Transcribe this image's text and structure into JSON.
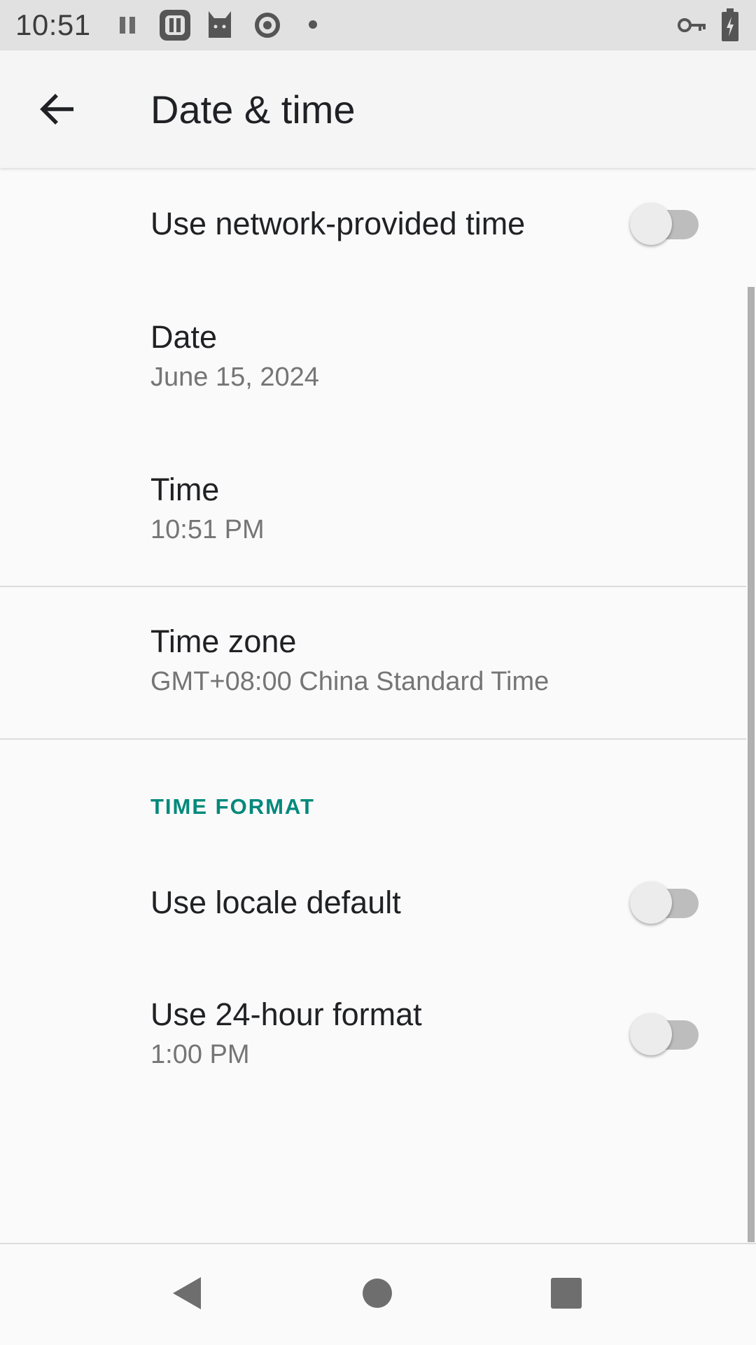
{
  "status_bar": {
    "time": "10:51",
    "icons": [
      "pause-icon",
      "app-icon",
      "cat-icon",
      "sync-icon",
      "dot-icon",
      "vpn-key-icon",
      "battery-charging-icon"
    ]
  },
  "app_bar": {
    "back_icon": "arrow-back-icon",
    "title": "Date & time"
  },
  "settings": {
    "network_time": {
      "title": "Use network-provided time",
      "enabled": false
    },
    "date": {
      "title": "Date",
      "value": "June 15, 2024"
    },
    "time": {
      "title": "Time",
      "value": "10:51 PM"
    },
    "time_zone": {
      "title": "Time zone",
      "value": "GMT+08:00 China Standard Time"
    },
    "time_format_header": "TIME FORMAT",
    "locale_default": {
      "title": "Use locale default",
      "enabled": false
    },
    "hour_24": {
      "title": "Use 24-hour format",
      "value": "1:00 PM",
      "enabled": false
    }
  },
  "nav_bar": {
    "buttons": [
      "back-triangle-icon",
      "home-circle-icon",
      "recents-square-icon"
    ]
  },
  "colors": {
    "accent": "#00897b",
    "status_bar": "#e1e1e1",
    "background": "#fafafa"
  }
}
